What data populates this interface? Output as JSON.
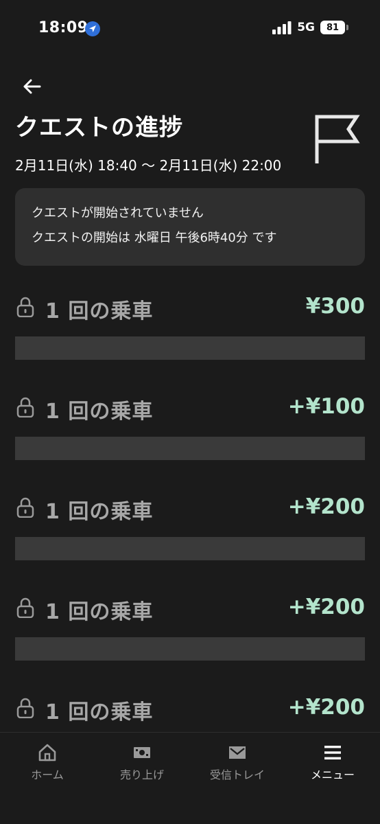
{
  "status_bar": {
    "time": "18:09",
    "network": "5G",
    "battery": "81"
  },
  "header": {
    "back_icon": "arrow-left-icon",
    "title": "クエストの進捗",
    "date_range": "2月11日(水) 18:40 〜 2月11日(水) 22:00",
    "flag_icon": "flag-icon"
  },
  "notice": {
    "line1": "クエストが開始されていません",
    "line2": "クエストの開始は 水曜日 午後6時40分 です"
  },
  "quests": [
    {
      "label": "1 回の乗車",
      "reward": "¥300",
      "progress": 0
    },
    {
      "label": "1 回の乗車",
      "reward": "+¥100",
      "progress": 0
    },
    {
      "label": "1 回の乗車",
      "reward": "+¥200",
      "progress": 0
    },
    {
      "label": "1 回の乗車",
      "reward": "+¥200",
      "progress": 0
    },
    {
      "label": "1 回の乗車",
      "reward": "+¥200",
      "progress": 0
    }
  ],
  "nav": {
    "items": [
      {
        "label": "ホーム",
        "icon": "home-icon"
      },
      {
        "label": "売り上げ",
        "icon": "cash-icon"
      },
      {
        "label": "受信トレイ",
        "icon": "mail-icon"
      },
      {
        "label": "メニュー",
        "icon": "menu-icon"
      }
    ],
    "active_index": 3
  },
  "colors": {
    "background": "#1b1b1b",
    "card": "#2f2f2f",
    "reward": "#b3e4cc",
    "muted_text": "#a8a8a8",
    "progress_track": "#3a3a3a"
  }
}
